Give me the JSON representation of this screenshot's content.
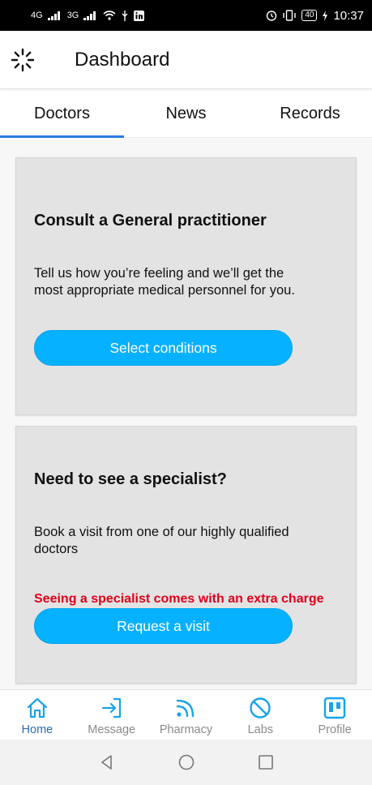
{
  "status_bar": {
    "network_left": "4G",
    "network_right": "3G",
    "battery": "40",
    "time": "10:37"
  },
  "app_bar": {
    "title": "Dashboard",
    "menu_icon": "loading-spinner-icon"
  },
  "tabs": [
    {
      "label": "Doctors",
      "active": true
    },
    {
      "label": "News",
      "active": false
    },
    {
      "label": "Records",
      "active": false
    }
  ],
  "cards": {
    "general": {
      "title": "Consult a General practitioner",
      "text": "Tell us how you’re feeling and we’ll get the most appropriate medical personnel for you.",
      "button": "Select conditions"
    },
    "specialist": {
      "title": "Need to see a specialist?",
      "text": "Book a visit from one of our highly qualified doctors",
      "warning": "Seeing a specialist comes with an extra charge",
      "button": "Request a visit"
    }
  },
  "bottom_nav": [
    {
      "label": "Home",
      "icon": "home-icon",
      "active": true
    },
    {
      "label": "Message",
      "icon": "login-arrow-icon",
      "active": false
    },
    {
      "label": "Pharmacy",
      "icon": "rss-feed-icon",
      "active": false
    },
    {
      "label": "Labs",
      "icon": "block-icon",
      "active": false
    },
    {
      "label": "Profile",
      "icon": "board-icon",
      "active": false
    }
  ],
  "colors": {
    "accent_blue": "#06b1ff",
    "tab_indicator": "#2a7de1",
    "warning_red": "#e1001a",
    "icon_blue": "#1aa3e8"
  }
}
